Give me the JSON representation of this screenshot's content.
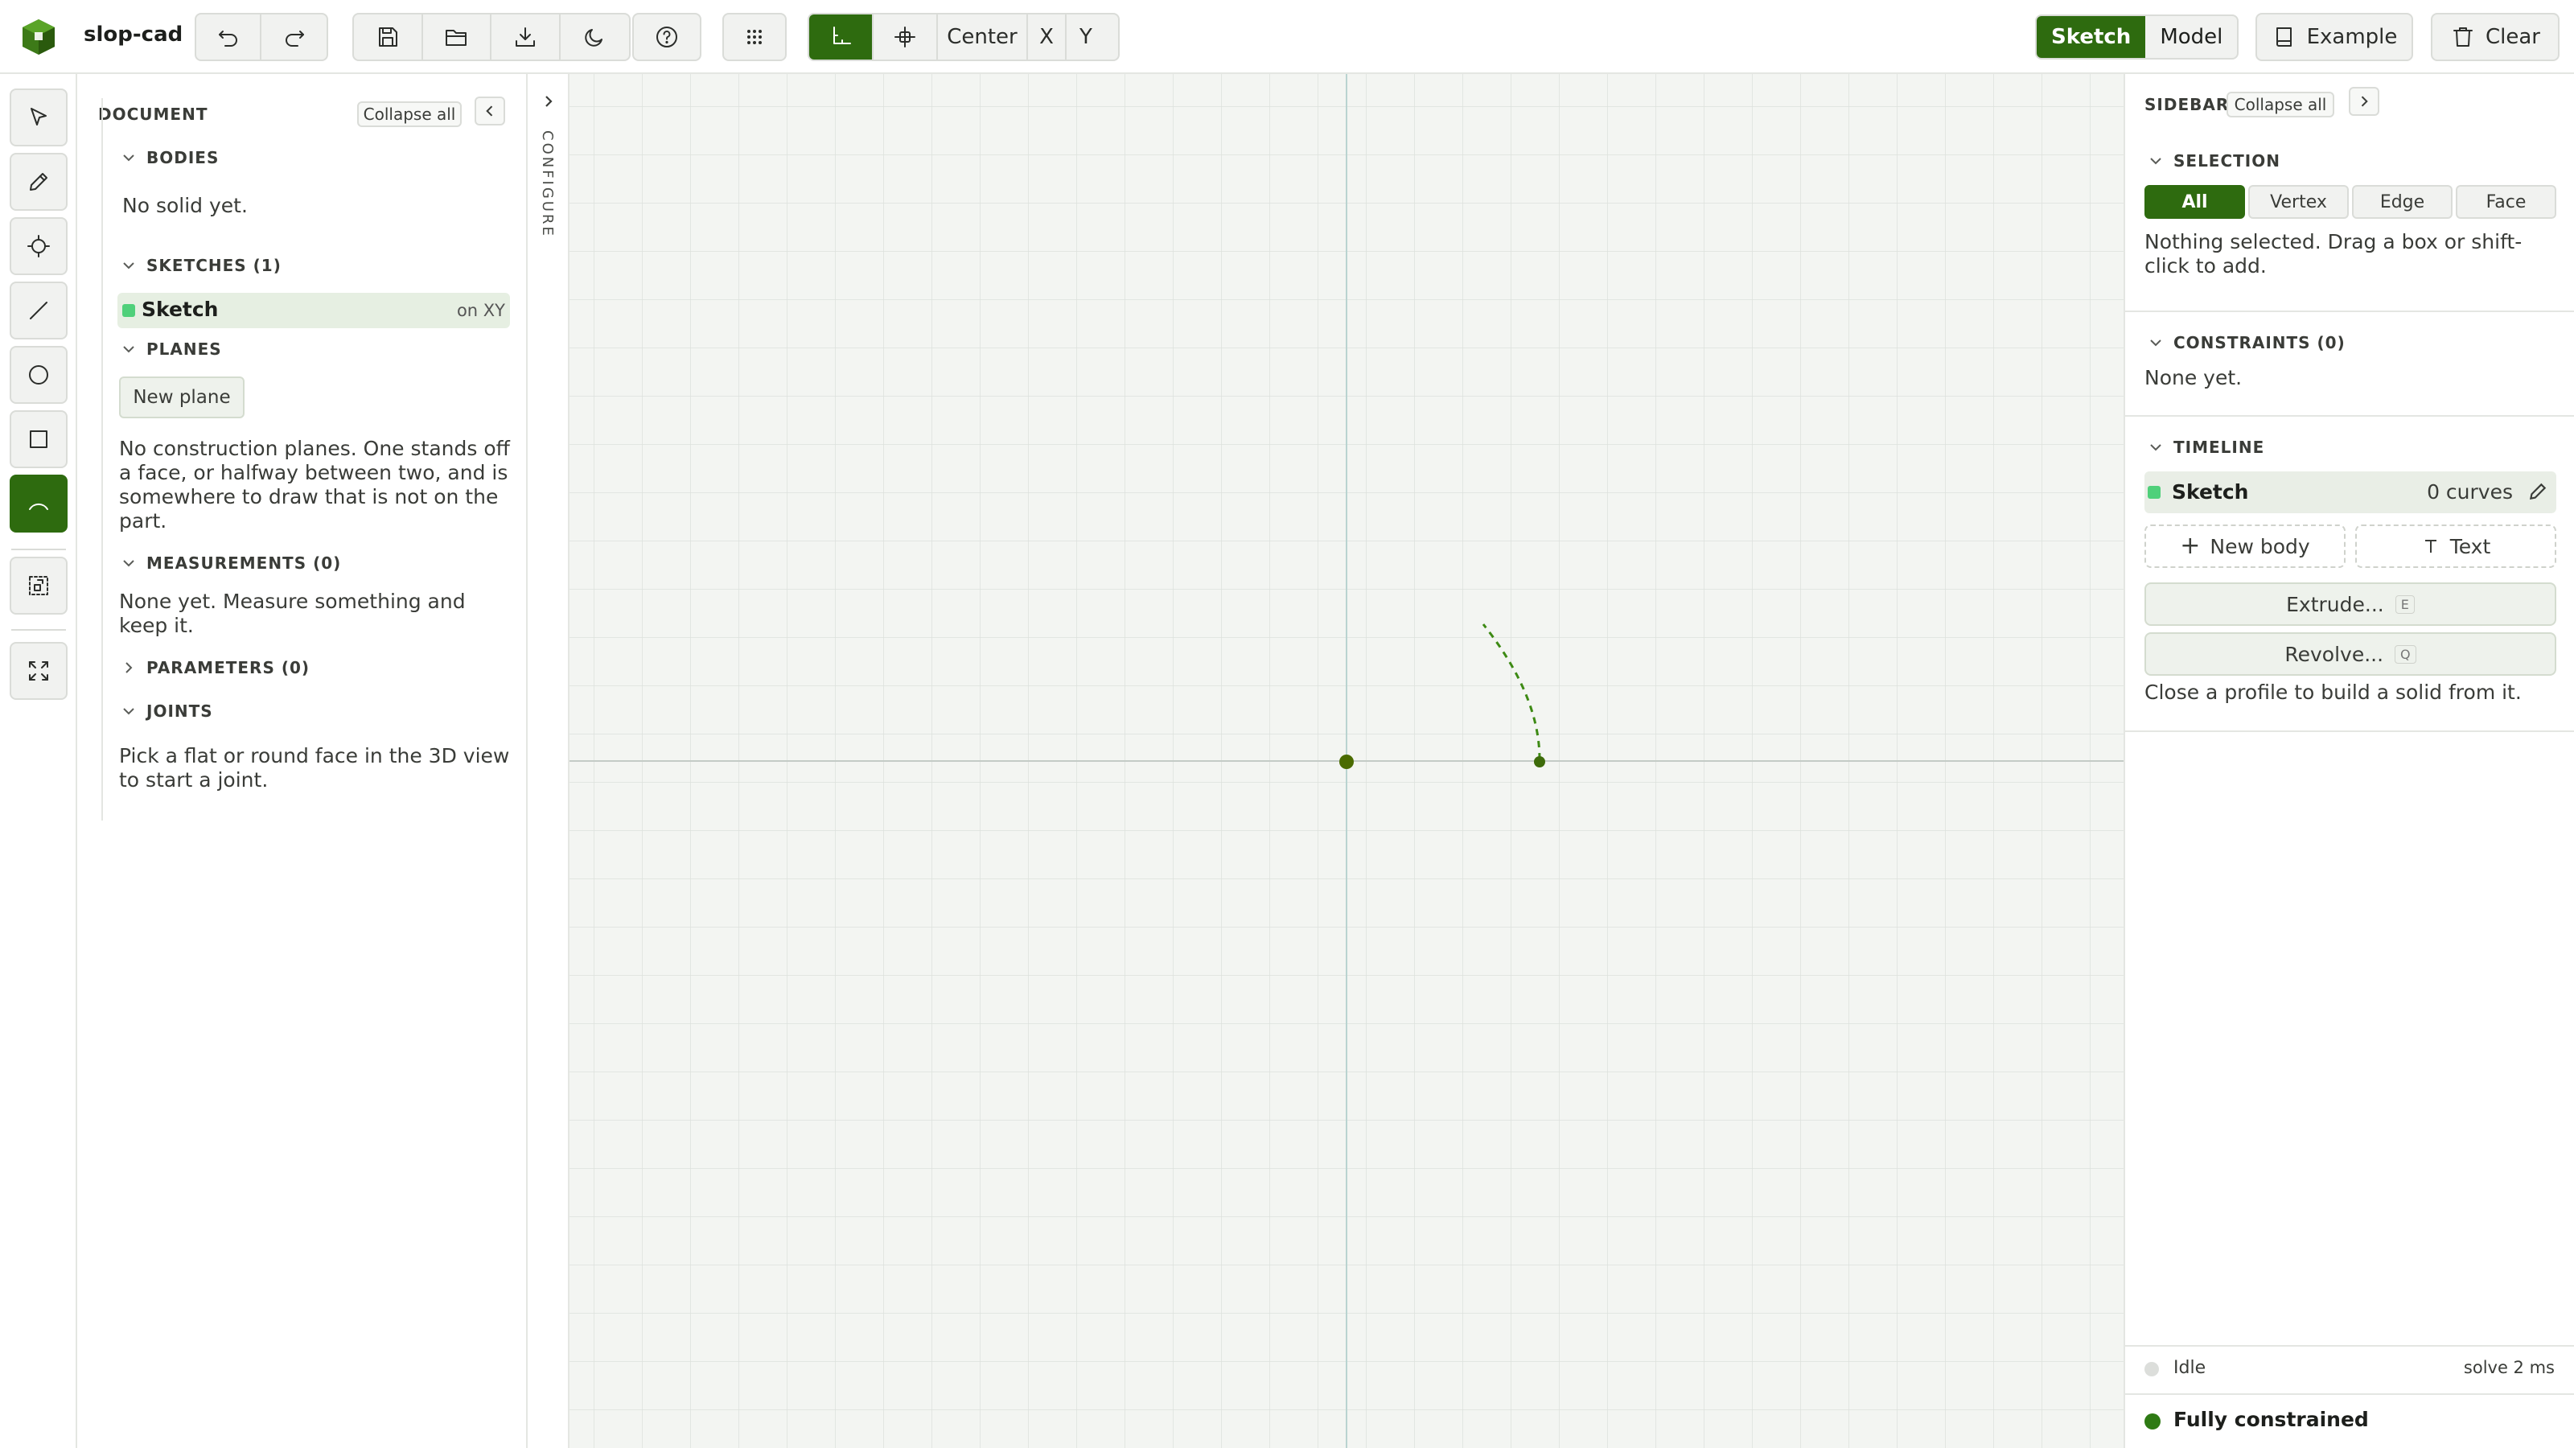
{
  "app": {
    "name": "slop-cad"
  },
  "toolbar": {
    "center_label": "Center",
    "x_label": "X",
    "y_label": "Y",
    "mode_sketch": "Sketch",
    "mode_model": "Model",
    "example_label": "Example",
    "clear_label": "Clear"
  },
  "document": {
    "title": "DOCUMENT",
    "collapse_all": "Collapse all",
    "bodies": {
      "title": "BODIES",
      "empty": "No solid yet."
    },
    "sketches": {
      "title": "SKETCHES (1)",
      "items": [
        {
          "name": "Sketch",
          "plane": "on XY"
        }
      ]
    },
    "planes": {
      "title": "PLANES",
      "new_plane": "New plane",
      "empty": "No construction planes. One stands off a face, or halfway between two, and is somewhere to draw that is not on the part."
    },
    "measurements": {
      "title": "MEASUREMENTS (0)",
      "empty": "None yet. Measure something and keep it."
    },
    "parameters": {
      "title": "PARAMETERS (0)"
    },
    "joints": {
      "title": "JOINTS",
      "empty": "Pick a flat or round face in the 3D view to start a joint."
    }
  },
  "configure": {
    "label": "CONFIGURE"
  },
  "sidebar": {
    "title": "SIDEBAR",
    "collapse_all": "Collapse all",
    "selection": {
      "title": "SELECTION",
      "filters": [
        "All",
        "Vertex",
        "Edge",
        "Face"
      ],
      "active": "All",
      "empty": "Nothing selected. Drag a box or shift-click to add."
    },
    "constraints": {
      "title": "CONSTRAINTS (0)",
      "empty": "None yet."
    },
    "timeline": {
      "title": "TIMELINE",
      "item": {
        "name": "Sketch",
        "count": "0 curves"
      },
      "new_body": "New body",
      "text": "Text",
      "extrude": "Extrude...",
      "extrude_key": "E",
      "revolve": "Revolve...",
      "revolve_key": "Q",
      "hint": "Close a profile to build a solid from it."
    },
    "status": {
      "state": "Idle",
      "solve": "solve 2 ms",
      "constraint_state": "Fully constrained"
    }
  },
  "colors": {
    "accent": "#2e6b0f",
    "sketch_dot": "#4fd07a",
    "curve": "#3d8a14"
  }
}
